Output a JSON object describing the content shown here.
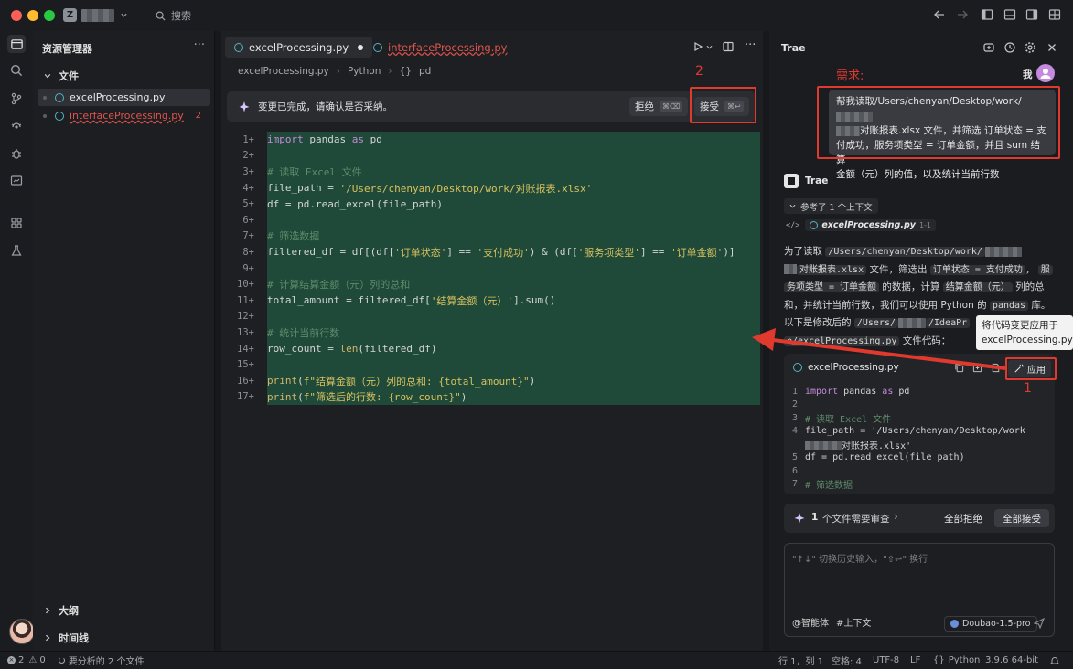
{
  "titlebar": {
    "workspace_badge": "Z",
    "search_label": "搜索"
  },
  "explorer": {
    "title": "资源管理器",
    "more": "···",
    "folder": "文件",
    "files": [
      {
        "name": "excelProcessing.py",
        "selected": true,
        "errors": ""
      },
      {
        "name": "interfaceProcessing.py",
        "selected": false,
        "errors": "2"
      }
    ],
    "outline": "大纲",
    "timeline": "时间线"
  },
  "editor": {
    "tabs": [
      {
        "name": "excelProcessing.py",
        "modified": true
      },
      {
        "name": "interfaceProcessing.py",
        "modified": false
      }
    ],
    "breadcrumb": [
      "excelProcessing.py",
      "Python",
      "{}",
      "pd"
    ],
    "banner": {
      "text": "变更已完成，请确认是否采纳。",
      "reject": "拒绝",
      "reject_kbd": "⌘⌫",
      "accept": "接受",
      "accept_kbd": "⌘↩"
    },
    "lines": [
      {
        "n": "1+",
        "code": "import pandas as pd"
      },
      {
        "n": "2+",
        "code": ""
      },
      {
        "n": "3+",
        "code": "# 读取 Excel 文件"
      },
      {
        "n": "4+",
        "code": "file_path = '/Users/chenyan/Desktop/work/对账报表.xlsx'"
      },
      {
        "n": "5+",
        "code": "df = pd.read_excel(file_path)"
      },
      {
        "n": "6+",
        "code": ""
      },
      {
        "n": "7+",
        "code": "# 筛选数据"
      },
      {
        "n": "8+",
        "code": "filtered_df = df[(df['订单状态'] == '支付成功') & (df['服务项类型'] == '订单金额')]"
      },
      {
        "n": "9+",
        "code": ""
      },
      {
        "n": "10+",
        "code": "# 计算结算金额（元）列的总和"
      },
      {
        "n": "11+",
        "code": "total_amount = filtered_df['结算金额（元）'].sum()"
      },
      {
        "n": "12+",
        "code": ""
      },
      {
        "n": "13+",
        "code": "# 统计当前行数"
      },
      {
        "n": "14+",
        "code": "row_count = len(filtered_df)"
      },
      {
        "n": "15+",
        "code": ""
      },
      {
        "n": "16+",
        "code": "print(f\"结算金额（元）列的总和: {total_amount}\")"
      },
      {
        "n": "17+",
        "code": "print(f\"筛选后的行数: {row_count}\")"
      }
    ]
  },
  "chat": {
    "title": "Trae",
    "user_label": "我",
    "annotation_requirement": "需求:",
    "request_lines": [
      "帮我读取/Users/chenyan/Desktop/work/",
      "对账报表.xlsx 文件，并筛选 订单状态 = 支",
      "付成功，服务项类型 = 订单金额，并且 sum 结算",
      "金额（元）列的值，以及统计当前行数"
    ],
    "bot_name": "Trae",
    "context_ref": "参考了 1 个上下文",
    "file_ref": "excelProcessing.py",
    "file_ref_range": "1-1",
    "reply": {
      "p1": "为了读取",
      "path1": "/Users/chenyan/Desktop/work/",
      "path2": "对账报表.xlsx",
      "p2": "文件，筛选出",
      "c1": "订单状态 = 支付成功",
      "p3": "，",
      "c2a": "服",
      "c2b": "务项类型 = 订单金额",
      "p4": "的数据，计算",
      "c3": "结算金额（元）",
      "p5": "列的总",
      "p6": "和，并统计当前行数，我们可以使用 Python 的",
      "c4": "pandas",
      "p7": "库。",
      "p8": "以下是修改后的",
      "c5a": "/Users/",
      "c5b": "/IdeaPr",
      "c6": "e/excelProcessing.py",
      "p9": "文件代码："
    },
    "tooltip": [
      "将代码变更应用于",
      "excelProcessing.py"
    ],
    "snippet": {
      "file": "excelProcessing.py",
      "apply": "应用",
      "lines": [
        {
          "n": "1",
          "code": "import pandas as pd"
        },
        {
          "n": "2",
          "code": ""
        },
        {
          "n": "3",
          "code": "# 读取 Excel 文件"
        },
        {
          "n": "4",
          "code": "file_path = '/Users/chenyan/Desktop/work"
        },
        {
          "n": "",
          "code": "对账报表.xlsx'"
        },
        {
          "n": "5",
          "code": "df = pd.read_excel(file_path)"
        },
        {
          "n": "6",
          "code": ""
        },
        {
          "n": "7",
          "code": "# 筛选数据"
        }
      ]
    },
    "review": {
      "count": "1",
      "text": "个文件需要审查",
      "reject_all": "全部拒绝",
      "accept_all": "全部接受"
    },
    "input_placeholder": "\"↑↓\" 切换历史输入，\"⇧↩\" 换行",
    "agent": "@智能体",
    "context_btn": "#上下文",
    "model": "Doubao-1.5-pro"
  },
  "annotations": {
    "num1": "1",
    "num2": "2"
  },
  "status": {
    "errors": "2",
    "warnings": "0",
    "analyzing": "要分析的 2 个文件",
    "position": "行 1，列 1",
    "spaces": "空格: 4",
    "encoding": "UTF-8",
    "eol": "LF",
    "language": "Python",
    "version": "3.9.6 64-bit"
  },
  "colors": {
    "accent_red": "#e03a2e",
    "diff_green": "#1f4a39",
    "keyword": "#c68bd8",
    "string": "#d8c15f",
    "comment": "#5e8a6c"
  }
}
